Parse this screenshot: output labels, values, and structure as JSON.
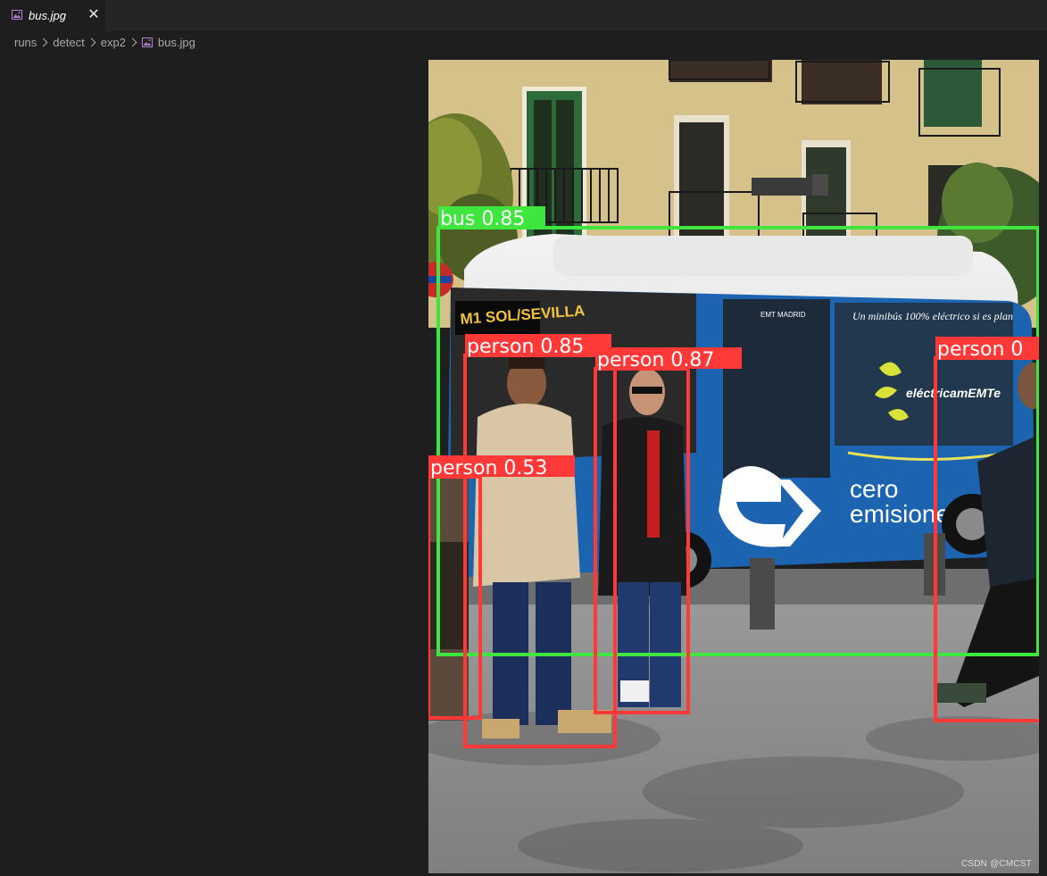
{
  "tab": {
    "icon": "image-file-icon",
    "label": "bus.jpg",
    "close_glyph": "✕"
  },
  "breadcrumb": {
    "items": [
      "runs",
      "detect",
      "exp2",
      "bus.jpg"
    ]
  },
  "detections": [
    {
      "label": "bus 0.85",
      "color": "#3ee63e"
    },
    {
      "label": "person 0.85",
      "color": "#ff3838"
    },
    {
      "label": "person 0.87",
      "color": "#ff3838"
    },
    {
      "label": "person 0.53",
      "color": "#ff3838"
    },
    {
      "label": "person 0",
      "color": "#ff3838"
    }
  ],
  "bus_livery": {
    "route_sign": "M1 SOL/SEVILLA",
    "slogan": "Un minibús 100% eléctrico si es plan",
    "brand": "EMT MADRID",
    "campaign": "eléctricamEMTe",
    "cero": "cero",
    "emisiones": "emisiones"
  },
  "watermark": "CSDN @CMCST",
  "colors": {
    "editor_bg": "#1e1e1e",
    "tabbar_bg": "#252526",
    "bus_blue": "#1d64b0",
    "box_green": "#3ee63e",
    "box_red": "#ff3838"
  }
}
